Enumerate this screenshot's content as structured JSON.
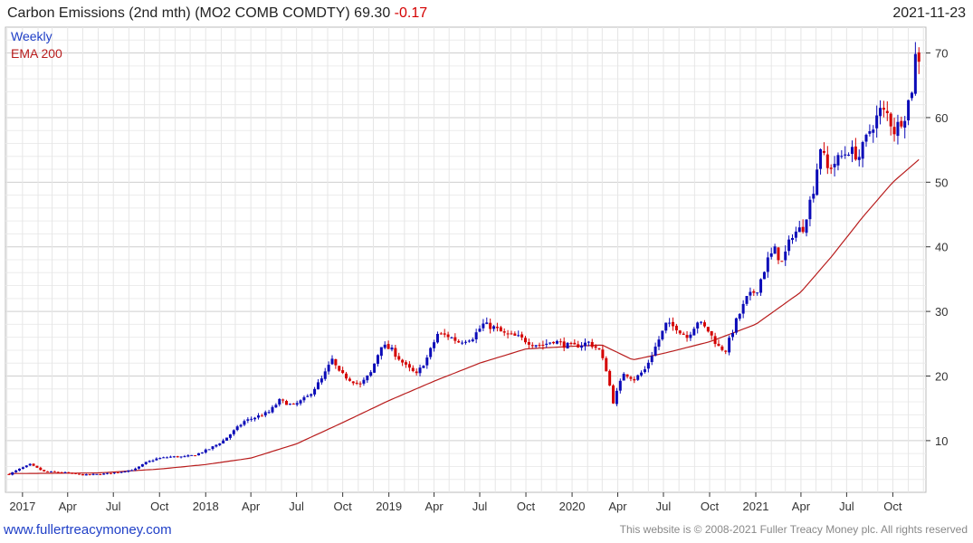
{
  "header": {
    "title": "Carbon Emissions (2nd mth) (MO2 COMB COMDTY) 69.30",
    "change": "-0.17"
  },
  "date": "2021-11-23",
  "footer": {
    "site": "www.fullertreacymoney.com",
    "copyright": "This website is © 2008-2021 Fuller Treacy Money plc. All rights reserved"
  },
  "colors": {
    "up": "#0b0bb8",
    "down": "#d40000",
    "ema": "#b81c1c",
    "grid": "#dedede",
    "axis": "#333333"
  },
  "chart_data": {
    "type": "candlestick",
    "legend": [
      "Weekly",
      "EMA 200"
    ],
    "legend_position": "top-left",
    "grid": true,
    "yaxis_side": "right",
    "ylim": [
      2,
      74
    ],
    "xlim": [
      "2016-11-28",
      "2021-12-06"
    ],
    "yticks": [
      10,
      20,
      30,
      40,
      50,
      60,
      70
    ],
    "xticks": [
      {
        "label": "2017",
        "date": "2017-01-01"
      },
      {
        "label": "Apr",
        "date": "2017-04-01"
      },
      {
        "label": "Jul",
        "date": "2017-07-01"
      },
      {
        "label": "Oct",
        "date": "2017-10-01"
      },
      {
        "label": "2018",
        "date": "2018-01-01"
      },
      {
        "label": "Apr",
        "date": "2018-04-01"
      },
      {
        "label": "Jul",
        "date": "2018-07-01"
      },
      {
        "label": "Oct",
        "date": "2018-10-01"
      },
      {
        "label": "2019",
        "date": "2019-01-01"
      },
      {
        "label": "Apr",
        "date": "2019-04-01"
      },
      {
        "label": "Jul",
        "date": "2019-07-01"
      },
      {
        "label": "Oct",
        "date": "2019-10-01"
      },
      {
        "label": "2020",
        "date": "2020-01-01"
      },
      {
        "label": "Apr",
        "date": "2020-04-01"
      },
      {
        "label": "Jul",
        "date": "2020-07-01"
      },
      {
        "label": "Oct",
        "date": "2020-10-01"
      },
      {
        "label": "2021",
        "date": "2021-01-01"
      },
      {
        "label": "Apr",
        "date": "2021-04-01"
      },
      {
        "label": "Jul",
        "date": "2021-07-01"
      },
      {
        "label": "Oct",
        "date": "2021-10-01"
      }
    ],
    "price_anchors": [
      [
        "2016-12-05",
        4.8
      ],
      [
        "2016-12-26",
        5.6
      ],
      [
        "2017-01-16",
        6.3
      ],
      [
        "2017-02-13",
        5.2
      ],
      [
        "2017-03-20",
        5.1
      ],
      [
        "2017-05-01",
        4.7
      ],
      [
        "2017-06-05",
        4.8
      ],
      [
        "2017-07-10",
        5.1
      ],
      [
        "2017-08-14",
        5.6
      ],
      [
        "2017-09-04",
        6.6
      ],
      [
        "2017-09-25",
        7.2
      ],
      [
        "2017-10-23",
        7.5
      ],
      [
        "2017-11-20",
        7.5
      ],
      [
        "2017-12-11",
        7.8
      ],
      [
        "2018-01-08",
        8.7
      ],
      [
        "2018-02-05",
        10.0
      ],
      [
        "2018-02-26",
        11.5
      ],
      [
        "2018-03-19",
        13.0
      ],
      [
        "2018-04-09",
        13.6
      ],
      [
        "2018-05-07",
        14.4
      ],
      [
        "2018-05-28",
        16.2
      ],
      [
        "2018-06-25",
        15.4
      ],
      [
        "2018-07-23",
        16.8
      ],
      [
        "2018-08-20",
        19.5
      ],
      [
        "2018-09-10",
        22.5
      ],
      [
        "2018-09-24",
        20.5
      ],
      [
        "2018-10-15",
        19.5
      ],
      [
        "2018-11-05",
        18.6
      ],
      [
        "2018-11-26",
        20.5
      ],
      [
        "2018-12-17",
        24.8
      ],
      [
        "2019-01-07",
        24.0
      ],
      [
        "2019-02-04",
        21.5
      ],
      [
        "2019-02-25",
        20.2
      ],
      [
        "2019-03-18",
        22.8
      ],
      [
        "2019-04-08",
        26.5
      ],
      [
        "2019-04-29",
        26.2
      ],
      [
        "2019-05-20",
        25.3
      ],
      [
        "2019-06-17",
        26.0
      ],
      [
        "2019-07-08",
        28.0
      ],
      [
        "2019-07-29",
        27.5
      ],
      [
        "2019-08-19",
        26.5
      ],
      [
        "2019-09-16",
        26.0
      ],
      [
        "2019-10-14",
        25.0
      ],
      [
        "2019-11-04",
        24.8
      ],
      [
        "2019-11-25",
        25.5
      ],
      [
        "2019-12-16",
        24.8
      ],
      [
        "2020-01-06",
        24.6
      ],
      [
        "2020-02-03",
        25.2
      ],
      [
        "2020-02-24",
        24.0
      ],
      [
        "2020-03-09",
        21.0
      ],
      [
        "2020-03-23",
        16.0
      ],
      [
        "2020-04-13",
        20.5
      ],
      [
        "2020-05-04",
        19.5
      ],
      [
        "2020-05-25",
        21.0
      ],
      [
        "2020-06-15",
        24.5
      ],
      [
        "2020-07-06",
        28.0
      ],
      [
        "2020-07-27",
        27.5
      ],
      [
        "2020-08-17",
        26.0
      ],
      [
        "2020-09-07",
        28.5
      ],
      [
        "2020-09-28",
        27.0
      ],
      [
        "2020-10-19",
        24.5
      ],
      [
        "2020-11-02",
        24.0
      ],
      [
        "2020-11-23",
        28.5
      ],
      [
        "2020-12-14",
        32.0
      ],
      [
        "2021-01-04",
        33.5
      ],
      [
        "2021-01-25",
        38.0
      ],
      [
        "2021-02-08",
        39.5
      ],
      [
        "2021-02-22",
        37.5
      ],
      [
        "2021-03-15",
        42.0
      ],
      [
        "2021-04-05",
        43.0
      ],
      [
        "2021-04-26",
        49.0
      ],
      [
        "2021-05-10",
        55.5
      ],
      [
        "2021-05-24",
        52.0
      ],
      [
        "2021-06-14",
        53.5
      ],
      [
        "2021-07-05",
        55.0
      ],
      [
        "2021-07-26",
        54.0
      ],
      [
        "2021-08-16",
        58.0
      ],
      [
        "2021-09-06",
        61.0
      ],
      [
        "2021-09-20",
        60.5
      ],
      [
        "2021-10-04",
        58.0
      ],
      [
        "2021-10-25",
        60.5
      ],
      [
        "2021-11-08",
        64.5
      ],
      [
        "2021-11-15",
        69.5
      ],
      [
        "2021-11-22",
        69.3
      ]
    ],
    "ema_anchors": [
      [
        "2016-12-05",
        4.9
      ],
      [
        "2017-06-01",
        5.0
      ],
      [
        "2017-10-01",
        5.6
      ],
      [
        "2018-01-01",
        6.3
      ],
      [
        "2018-04-01",
        7.3
      ],
      [
        "2018-07-01",
        9.5
      ],
      [
        "2018-10-01",
        12.8
      ],
      [
        "2019-01-01",
        16.2
      ],
      [
        "2019-04-01",
        19.2
      ],
      [
        "2019-07-01",
        22.0
      ],
      [
        "2019-10-01",
        24.2
      ],
      [
        "2020-01-01",
        24.6
      ],
      [
        "2020-03-01",
        24.8
      ],
      [
        "2020-05-01",
        22.5
      ],
      [
        "2020-07-01",
        23.5
      ],
      [
        "2020-10-01",
        25.3
      ],
      [
        "2021-01-01",
        28.0
      ],
      [
        "2021-04-01",
        33.0
      ],
      [
        "2021-06-01",
        38.5
      ],
      [
        "2021-08-01",
        44.5
      ],
      [
        "2021-10-01",
        50.0
      ],
      [
        "2021-11-22",
        53.5
      ]
    ]
  }
}
